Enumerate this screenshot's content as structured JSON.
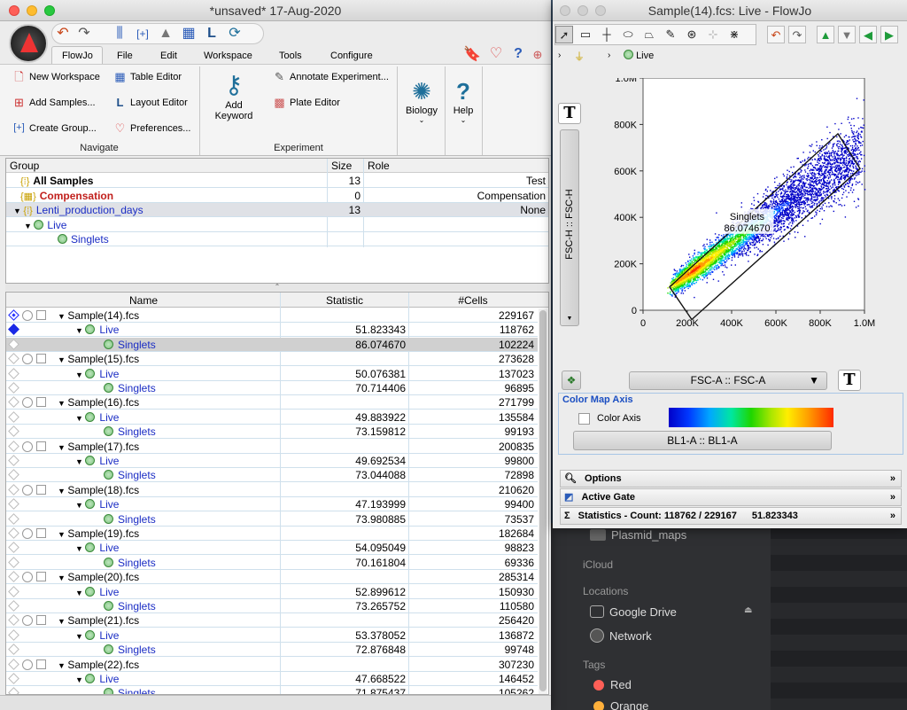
{
  "workspace": {
    "title": "*unsaved* 17-Aug-2020",
    "menus": [
      "FlowJo",
      "File",
      "Edit",
      "Workspace",
      "Tools",
      "Configure"
    ],
    "navigate": {
      "label": "Navigate",
      "new_workspace": "New Workspace",
      "add_samples": "Add Samples...",
      "create_group": "Create Group...",
      "table_editor": "Table Editor",
      "layout_editor": "Layout Editor",
      "preferences": "Preferences..."
    },
    "experiment": {
      "label": "Experiment",
      "add_keyword_1": "Add",
      "add_keyword_2": "Keyword",
      "annotate": "Annotate Experiment...",
      "plate_editor": "Plate Editor"
    },
    "biology": "Biology",
    "help": "Help",
    "group_table": {
      "headers": {
        "group": "Group",
        "size": "Size",
        "role": "Role"
      },
      "rows": [
        {
          "name": "All Samples",
          "size": "13",
          "role": "Test",
          "style": "bold"
        },
        {
          "name": "Compensation",
          "size": "0",
          "role": "Compensation",
          "style": "red"
        },
        {
          "name": "Lenti_production_days",
          "size": "13",
          "role": "None",
          "style": "blue"
        },
        {
          "name": "Live",
          "size": "",
          "role": "",
          "style": "blue"
        },
        {
          "name": "Singlets",
          "size": "",
          "role": "",
          "style": "blue"
        }
      ]
    },
    "sample_table": {
      "headers": {
        "name": "Name",
        "statistic": "Statistic",
        "cells": "#Cells"
      },
      "samples": [
        {
          "name": "Sample(14).fcs",
          "cells": "229167",
          "live_stat": "51.823343",
          "live_cells": "118762",
          "singlets_stat": "86.074670",
          "singlets_cells": "102224"
        },
        {
          "name": "Sample(15).fcs",
          "cells": "273628",
          "live_stat": "50.076381",
          "live_cells": "137023",
          "singlets_stat": "70.714406",
          "singlets_cells": "96895"
        },
        {
          "name": "Sample(16).fcs",
          "cells": "271799",
          "live_stat": "49.883922",
          "live_cells": "135584",
          "singlets_stat": "73.159812",
          "singlets_cells": "99193"
        },
        {
          "name": "Sample(17).fcs",
          "cells": "200835",
          "live_stat": "49.692534",
          "live_cells": "99800",
          "singlets_stat": "73.044088",
          "singlets_cells": "72898"
        },
        {
          "name": "Sample(18).fcs",
          "cells": "210620",
          "live_stat": "47.193999",
          "live_cells": "99400",
          "singlets_stat": "73.980885",
          "singlets_cells": "73537"
        },
        {
          "name": "Sample(19).fcs",
          "cells": "182684",
          "live_stat": "54.095049",
          "live_cells": "98823",
          "singlets_stat": "70.161804",
          "singlets_cells": "69336"
        },
        {
          "name": "Sample(20).fcs",
          "cells": "285314",
          "live_stat": "52.899612",
          "live_cells": "150930",
          "singlets_stat": "73.265752",
          "singlets_cells": "110580"
        },
        {
          "name": "Sample(21).fcs",
          "cells": "256420",
          "live_stat": "53.378052",
          "live_cells": "136872",
          "singlets_stat": "72.876848",
          "singlets_cells": "99748"
        },
        {
          "name": "Sample(22).fcs",
          "cells": "307230",
          "live_stat": "47.668522",
          "live_cells": "146452",
          "singlets_stat": "71.875437",
          "singlets_cells": "105262"
        }
      ],
      "live_label": "Live",
      "singlets_label": "Singlets"
    }
  },
  "graph_window": {
    "title": "Sample(14).fcs: Live - FlowJo",
    "breadcrumb": "Live",
    "y_axis_param": "FSC-H :: FSC-H",
    "x_axis_param": "FSC-A :: FSC-A",
    "y_ticks": [
      "1.0M",
      "800K",
      "600K",
      "400K",
      "200K",
      "0"
    ],
    "x_ticks": [
      "0",
      "200K",
      "400K",
      "600K",
      "800K",
      "1.0M"
    ],
    "gate_name": "Singlets",
    "gate_value": "86.074670",
    "color_map_title": "Color Map Axis",
    "color_axis_label": "Color Axis",
    "color_param": "BL1-A :: BL1-A",
    "panels": {
      "options": "Options",
      "active_gate": "Active Gate",
      "statistics": "Statistics  -  Count: 118762 / 229167",
      "statistics_value": "51.823343"
    }
  },
  "finder": {
    "folder": "Plasmid_maps",
    "icloud": "iCloud",
    "locations_header": "Locations",
    "google_drive": "Google Drive",
    "network": "Network",
    "tags_header": "Tags",
    "red": "Red",
    "orange": "Orange",
    "colors": {
      "red": "#ff5f57",
      "orange": "#ffb03b"
    }
  },
  "chart_data": {
    "type": "scatter",
    "xlabel": "FSC-A :: FSC-A",
    "ylabel": "FSC-H :: FSC-H",
    "xlim": [
      0,
      1000000
    ],
    "ylim": [
      0,
      1000000
    ],
    "x_ticks": [
      "0",
      "200K",
      "400K",
      "600K",
      "800K",
      "1.0M"
    ],
    "y_ticks": [
      "0",
      "200K",
      "400K",
      "600K",
      "800K",
      "1.0M"
    ],
    "density_model": {
      "slope": 0.68,
      "intercept": 20000,
      "x_start": 150000,
      "x_end": 980000,
      "densest_x": 230000
    },
    "gate": {
      "name": "Singlets",
      "value": "86.074670",
      "polygon": [
        [
          120000,
          100000
        ],
        [
          880000,
          760000
        ],
        [
          980000,
          610000
        ],
        [
          220000,
          -40000
        ]
      ]
    }
  }
}
